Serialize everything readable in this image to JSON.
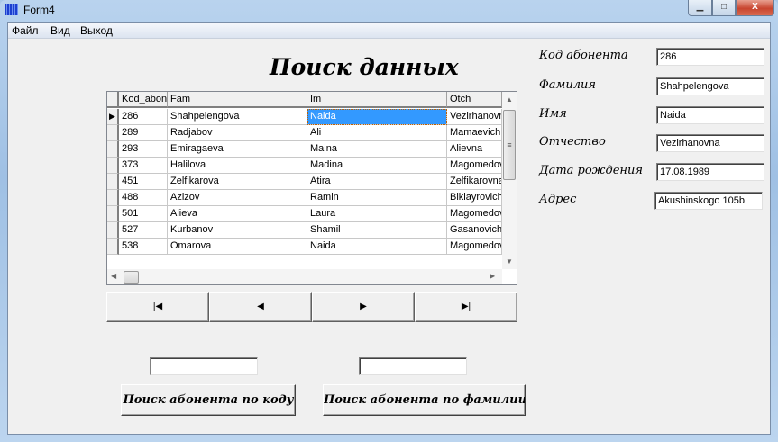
{
  "window": {
    "title": "Form4",
    "minimize": "▁",
    "maximize": "□",
    "close": "X"
  },
  "menu": [
    "Файл",
    "Вид",
    "Выход"
  ],
  "page_title": "Поиск данных",
  "grid": {
    "columns": [
      "Kod_abon",
      "Fam",
      "Im",
      "Otch"
    ],
    "rows": [
      [
        "286",
        "Shahpelengova",
        "Naida",
        "Vezirhanovna"
      ],
      [
        "289",
        "Radjabov",
        "Ali",
        "Mamaevich"
      ],
      [
        "293",
        "Emiragaeva",
        "Maina",
        "Alievna"
      ],
      [
        "373",
        "Halilova",
        "Madina",
        "Magomedovna"
      ],
      [
        "451",
        "Zelfikarova",
        "Atira",
        "Zelfikarovna"
      ],
      [
        "488",
        "Azizov",
        "Ramin",
        "Biklayrovich"
      ],
      [
        "501",
        "Alieva",
        "Laura",
        "Magomedovna"
      ],
      [
        "527",
        "Kurbanov",
        "Shamil",
        "Gasanovich"
      ],
      [
        "538",
        "Omarova",
        "Naida",
        "Magomedovna"
      ]
    ]
  },
  "navigator": {
    "first": "|◀",
    "prior": "◀",
    "next": "▶",
    "last": "▶|"
  },
  "details": {
    "kod_label": "Код абонента",
    "kod": "286",
    "fam_label": "Фамилия",
    "fam": "Shahpelengova",
    "im_label": "Имя",
    "im": "Naida",
    "otch_label": "Отчество",
    "otch": "Vezirhanovna",
    "dob_label": "Дата рождения",
    "dob": "17.08.1989",
    "addr_label": "Адрес",
    "addr": "Akushinskogo 105b"
  },
  "search": {
    "by_code_value": "",
    "by_name_value": "",
    "by_code_button": "Поиск абонента по коду",
    "by_name_button": "Поиск абонента по фамилии"
  }
}
